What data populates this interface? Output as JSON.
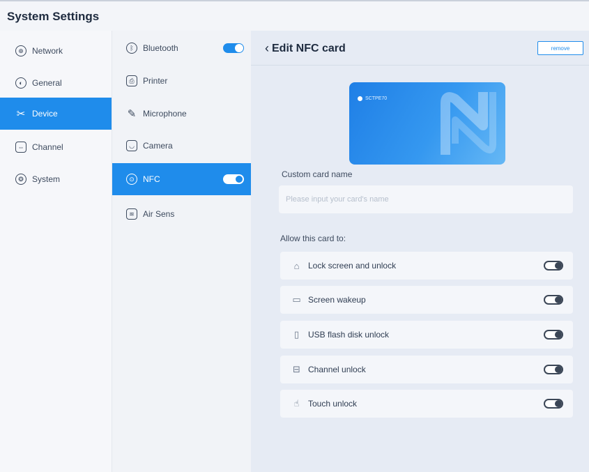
{
  "app": {
    "title": "System Settings"
  },
  "nav": {
    "items": [
      {
        "label": "Network",
        "icon": "globe-icon"
      },
      {
        "label": "General",
        "icon": "general-icon"
      },
      {
        "label": "Device",
        "icon": "tools-icon"
      },
      {
        "label": "Channel",
        "icon": "channel-icon"
      },
      {
        "label": "System",
        "icon": "system-gear-icon"
      }
    ],
    "active": "Device"
  },
  "device_menu": {
    "items": [
      {
        "label": "Bluetooth",
        "icon": "bluetooth-icon",
        "toggle": "on"
      },
      {
        "label": "Printer",
        "icon": "printer-icon"
      },
      {
        "label": "Microphone",
        "icon": "microphone-icon"
      },
      {
        "label": "Camera",
        "icon": "camera-icon"
      },
      {
        "label": "NFC",
        "icon": "nfc-icon",
        "toggle": "on"
      },
      {
        "label": "Air Sens",
        "icon": "air-sensor-icon"
      }
    ],
    "active": "NFC"
  },
  "detail": {
    "title": "Edit NFC card",
    "remove_label": "remove",
    "card_text": "SCTPE70",
    "name_label": "Custom card name",
    "name_placeholder": "Please input your card's name",
    "name_value": "",
    "allow_label": "Allow this card to:",
    "permissions": [
      {
        "label": "Lock screen and unlock",
        "icon": "lock-screen-icon",
        "enabled": false
      },
      {
        "label": "Screen wakeup",
        "icon": "screen-wakeup-icon",
        "enabled": false
      },
      {
        "label": "USB flash disk unlock",
        "icon": "usb-icon",
        "enabled": false
      },
      {
        "label": "Channel unlock",
        "icon": "channel-icon",
        "enabled": false
      },
      {
        "label": "Touch unlock",
        "icon": "touch-icon",
        "enabled": false
      }
    ]
  },
  "colors": {
    "accent": "#1f8ceb",
    "background": "#eef1f6",
    "panel": "#e6ebf4",
    "row": "#f4f6fa"
  }
}
